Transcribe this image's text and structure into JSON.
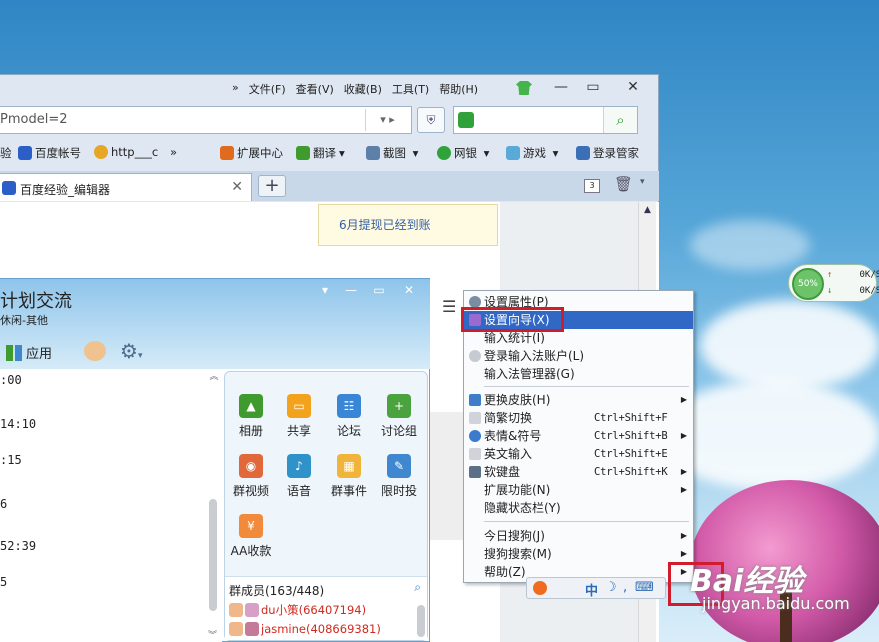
{
  "desktop": {
    "speed_meter": {
      "percent": "50%",
      "up": "0K/S",
      "down": "0K/S"
    },
    "watermark": {
      "logo": "Bai经验",
      "url": "jingyan.baidu.com"
    }
  },
  "browser": {
    "menu": [
      "文件(F)",
      "查看(V)",
      "收藏(B)",
      "工具(T)",
      "帮助(H)"
    ],
    "menu_more": "»",
    "address": "Pmodel=2",
    "favorites": {
      "left": [
        "验",
        "百度帐号",
        "http___c"
      ],
      "more": "»",
      "right": [
        "扩展中心",
        "翻译",
        "截图",
        "网银",
        "游戏",
        "登录管家"
      ]
    },
    "tab_title": "百度经验_编辑器",
    "tab_count": "3",
    "notice": "6月提现已经到账"
  },
  "qq": {
    "title": "计划交流",
    "subtitle": "休闲-其他",
    "app_label": "应用",
    "chat_times": [
      ":00",
      "14:10",
      ":15",
      "6",
      "52:39",
      "5"
    ],
    "apps": [
      {
        "label": "相册",
        "color": "#3f9b2d"
      },
      {
        "label": "共享",
        "color": "#f2a21c"
      },
      {
        "label": "论坛",
        "color": "#3a86d6"
      },
      {
        "label": "讨论组",
        "color": "#4aa33e"
      },
      {
        "label": "群视频",
        "color": "#e0683a"
      },
      {
        "label": "语音",
        "color": "#2f93c9"
      },
      {
        "label": "群事件",
        "color": "#f0b43a"
      },
      {
        "label": "限时投",
        "color": "#3f87cf"
      },
      {
        "label": "AA收款",
        "color": "#f18a3a"
      }
    ],
    "members_header": "群成员(163/448)",
    "members": [
      "du小策(66407194)",
      "jasmine(408669381)"
    ]
  },
  "context_menu": {
    "items": [
      {
        "label": "设置属性(P)",
        "shortcut": "",
        "submenu": false,
        "highlight": false
      },
      {
        "label": "设置向导(X)",
        "shortcut": "",
        "submenu": false,
        "highlight": true
      },
      {
        "label": "输入统计(I)",
        "shortcut": "",
        "submenu": false,
        "highlight": false
      },
      {
        "label": "登录输入法账户(L)",
        "shortcut": "",
        "submenu": false,
        "highlight": false
      },
      {
        "label": "输入法管理器(G)",
        "shortcut": "",
        "submenu": false,
        "highlight": false
      },
      {
        "label": "更换皮肤(H)",
        "shortcut": "",
        "submenu": true,
        "highlight": false
      },
      {
        "label": "简繁切换",
        "shortcut": "Ctrl+Shift+F",
        "submenu": false,
        "highlight": false
      },
      {
        "label": "表情&符号",
        "shortcut": "Ctrl+Shift+B",
        "submenu": true,
        "highlight": false
      },
      {
        "label": "英文输入",
        "shortcut": "Ctrl+Shift+E",
        "submenu": false,
        "highlight": false
      },
      {
        "label": "软键盘",
        "shortcut": "Ctrl+Shift+K",
        "submenu": true,
        "highlight": false
      },
      {
        "label": "扩展功能(N)",
        "shortcut": "",
        "submenu": true,
        "highlight": false
      },
      {
        "label": "隐藏状态栏(Y)",
        "shortcut": "",
        "submenu": false,
        "highlight": false
      },
      {
        "label": "今日搜狗(J)",
        "shortcut": "",
        "submenu": true,
        "highlight": false
      },
      {
        "label": "搜狗搜索(M)",
        "shortcut": "",
        "submenu": true,
        "highlight": false
      },
      {
        "label": "帮助(Z)",
        "shortcut": "",
        "submenu": true,
        "highlight": false
      }
    ]
  },
  "ime_bar": {
    "text": "中"
  }
}
